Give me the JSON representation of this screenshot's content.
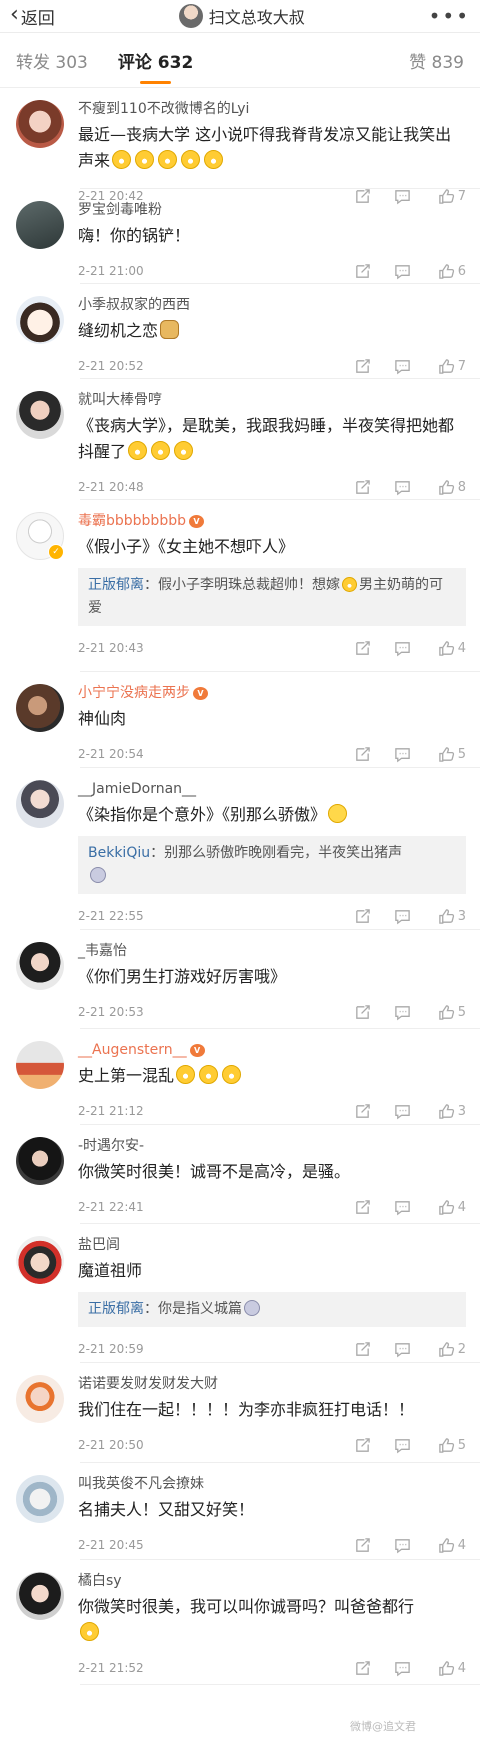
{
  "header": {
    "back_label": "返回",
    "title": "扫文总攻大叔",
    "more_label": "•••"
  },
  "tabs": {
    "repost_label": "转发",
    "repost_count": "303",
    "comment_label": "评论",
    "comment_count": "632",
    "like_label": "赞",
    "like_count": "839"
  },
  "comments": [
    {
      "user": "不瘦到110不改微博名的Lyi",
      "text": "最近—丧病大学 这小说吓得我脊背发凉又能让我笑出声来",
      "emojis": 5,
      "time": "2-21 20:42",
      "likes": "7"
    },
    {
      "user": "罗宝剑毒唯粉",
      "text": "嗨！你的锅铲！",
      "time": "2-21 21:00",
      "likes": "6"
    },
    {
      "user": "小季叔叔家的西西",
      "text": "缝纫机之恋",
      "time": "2-21 20:52",
      "likes": "7"
    },
    {
      "user": "就叫大棒骨哼",
      "text": "《丧病大学》，是耽美，我跟我妈睡，半夜笑得把她都抖醒了",
      "time": "2-21 20:48",
      "likes": "8"
    },
    {
      "user": "毒霸bbbbbbbbb",
      "text": "《假小子》《女主她不想吓人》",
      "reply_name": "正版郁离",
      "reply_text": "假小子李明珠总裁超帅！想嫁",
      "reply_tail": "男主奶萌的可爱",
      "time": "2-21 20:43",
      "likes": "4"
    },
    {
      "user": "小宁宁没病走两步",
      "text": "神仙肉",
      "time": "2-21 20:54",
      "likes": "5"
    },
    {
      "user": "__JamieDornan__",
      "text": "《染指你是个意外》《别那么骄傲》",
      "reply_name": "BekkiQiu",
      "reply_text": "别那么骄傲昨晚刚看完，半夜笑出猪声",
      "time": "2-21 22:55",
      "likes": "3"
    },
    {
      "user": "_韦嘉怡",
      "text": "《你们男生打游戏好厉害哦》",
      "time": "2-21 20:53",
      "likes": "5"
    },
    {
      "user": "__Augenstern__",
      "text": "史上第一混乱",
      "time": "2-21 21:12",
      "likes": "3"
    },
    {
      "user": "-时遇尔安-",
      "text": "你微笑时很美！诚哥不是高冷，是骚。",
      "time": "2-21 22:41",
      "likes": "4"
    },
    {
      "user": "盐巴闾",
      "text": "魔道祖师",
      "reply_name": "正版郁离",
      "reply_text": "你是指义城篇",
      "time": "2-21 20:59",
      "likes": "2"
    },
    {
      "user": "诺诺要发财发财发大财",
      "text": "我们住在一起！！！！为李亦非疯狂打电话！！",
      "time": "2-21 20:50",
      "likes": "5"
    },
    {
      "user": "叫我英俊不凡会撩妹",
      "text": "名捕夫人！又甜又好笑！",
      "time": "2-21 20:45",
      "likes": "4"
    },
    {
      "user": "橘白sy",
      "text": "你微笑时很美，我可以叫你诚哥吗？叫爸爸都行",
      "time": "2-21 21:52",
      "likes": "4"
    }
  ],
  "watermark": "微博@追文君",
  "colors": {
    "accent": "#ff8200",
    "reply_name": "#3a6ea5",
    "vip_name": "#eb7350"
  }
}
